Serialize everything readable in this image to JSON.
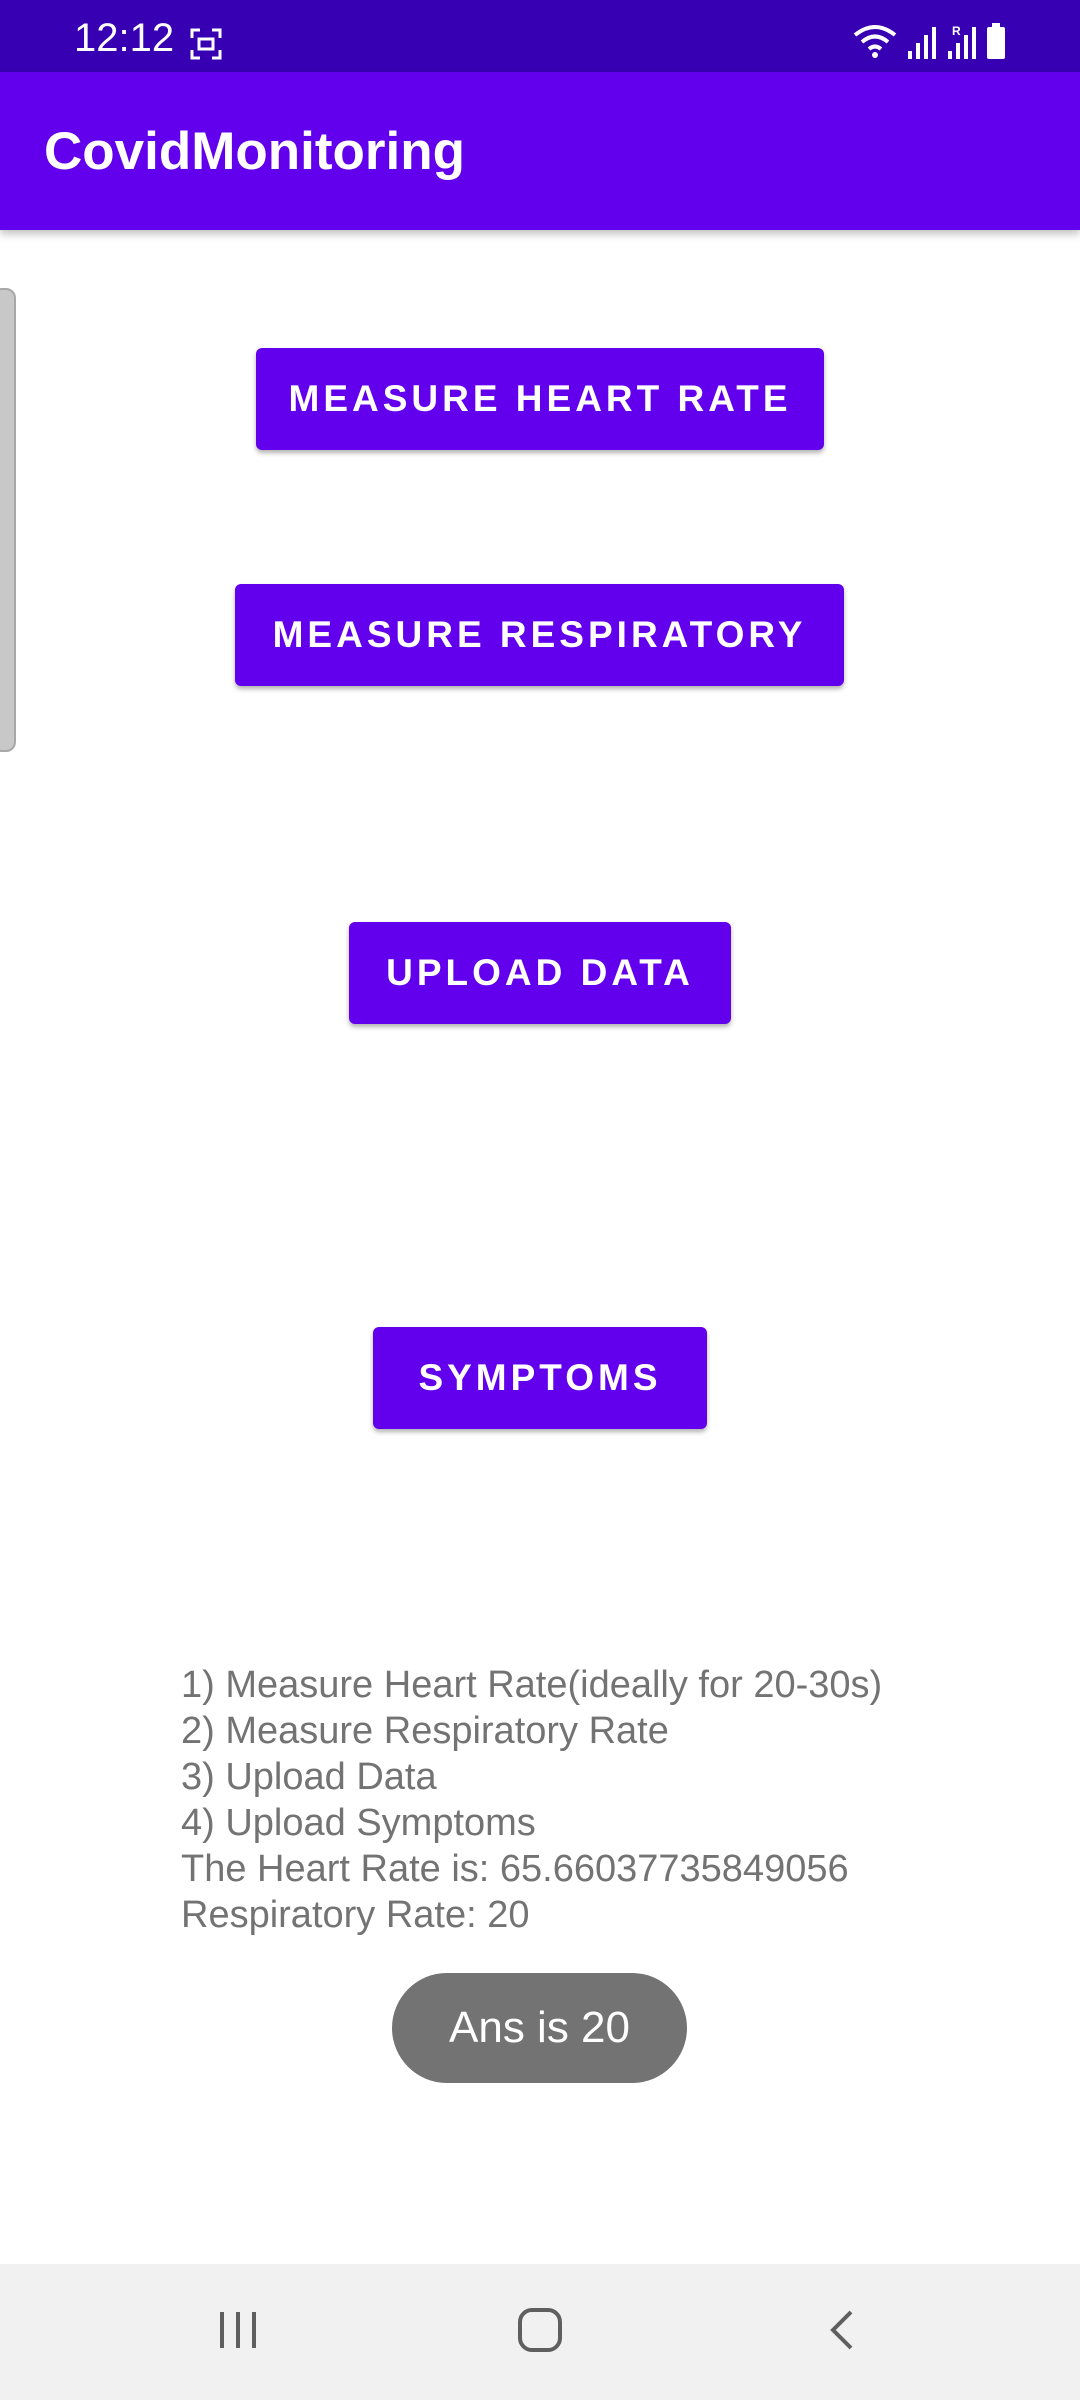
{
  "status_bar": {
    "time": "12:12",
    "background_color": "#3700b3"
  },
  "app_bar": {
    "title": "CovidMonitoring",
    "background_color": "#6200ee"
  },
  "buttons": {
    "measure_heart_rate": "MEASURE HEART RATE",
    "measure_respiratory": "MEASURE RESPIRATORY",
    "upload_data": "UPLOAD DATA",
    "symptoms": "SYMPTOMS",
    "color": "#6200ee"
  },
  "instructions": {
    "lines": [
      "1) Measure Heart Rate(ideally for 20-30s)",
      "2) Measure Respiratory Rate",
      "3) Upload Data",
      "4) Upload Symptoms",
      "The Heart Rate is: 65.66037735849056",
      "Respiratory Rate: 20"
    ]
  },
  "toast": {
    "message": "Ans is 20"
  },
  "icons": {
    "status": [
      "screenshot-icon",
      "wifi-icon",
      "signal-icon",
      "roaming-signal-icon",
      "battery-icon"
    ],
    "nav": [
      "recents-icon",
      "home-icon",
      "back-icon"
    ]
  }
}
